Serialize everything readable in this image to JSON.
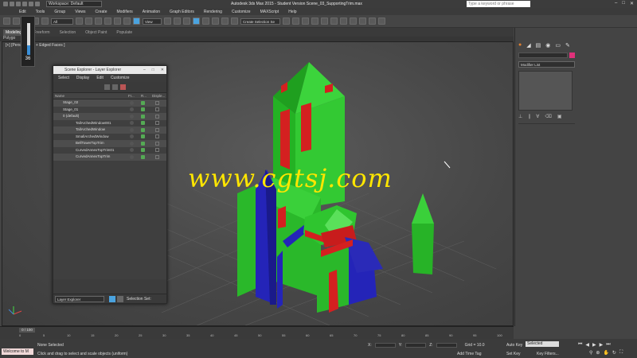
{
  "titlebar": {
    "workspace": "Workspace: Default",
    "app_title": "Autodesk 3ds Max 2015 - Student Version  Scene_03_SupportingTrim.max",
    "search_placeholder": "Type a keyword or phrase"
  },
  "menubar": [
    "Edit",
    "Tools",
    "Group",
    "Views",
    "Create",
    "Modifiers",
    "Animation",
    "Graph Editors",
    "Rendering",
    "Customize",
    "MAXScript",
    "Help"
  ],
  "toolbar": {
    "filter_value": "All",
    "view_value": "View",
    "selection_set_placeholder": "Create Selection Se"
  },
  "ribbon": {
    "tabs": [
      "Modeling",
      "Freeform",
      "Selection",
      "Object Paint",
      "Populate"
    ],
    "sub_label": "Polygo"
  },
  "viewport": {
    "label": "[+] [Pers",
    "label_tail": "alts + Edged Faces ]",
    "watermark": "www.cgtsj.com"
  },
  "counter_widget": {
    "value": "36",
    "level": 0.36
  },
  "scene_explorer": {
    "title": "Scene Explorer - Layer Explorer",
    "menu": [
      "Select",
      "Display",
      "Edit",
      "Customize"
    ],
    "columns": [
      "Name",
      "Fr...",
      "R...",
      "Disple..."
    ],
    "rows": [
      {
        "name": "Stage_02",
        "indent": 1
      },
      {
        "name": "Stage_01",
        "indent": 1
      },
      {
        "name": "0 (default)",
        "indent": 1
      },
      {
        "name": "TallArchedWindow001",
        "indent": 2
      },
      {
        "name": "TallArchedWindow",
        "indent": 2
      },
      {
        "name": "SmallArchedWindow",
        "indent": 2
      },
      {
        "name": "BellTowerTopTrim",
        "indent": 2
      },
      {
        "name": "CurvedAnnexTopTrim01",
        "indent": 2
      },
      {
        "name": "CurvedAnnexTopTrim",
        "indent": 2
      }
    ],
    "footer_dropdown": "Layer Explorer",
    "footer_label": "Selection Set:"
  },
  "command_panel": {
    "modifier_list": "Modifier List"
  },
  "timeline": {
    "frame": "0 / 100",
    "ticks": [
      "0",
      "5",
      "10",
      "15",
      "20",
      "25",
      "30",
      "35",
      "40",
      "45",
      "50",
      "55",
      "60",
      "65",
      "70",
      "75",
      "80",
      "85",
      "90",
      "95",
      "100"
    ]
  },
  "statusbar": {
    "welcome": "Welcome to M",
    "selection": "None Selected",
    "prompt": "Click and drag to select and scale objects (uniform)",
    "x_label": "X:",
    "y_label": "Y:",
    "z_label": "Z:",
    "grid": "Grid = 10.0",
    "auto_key": "Auto Key",
    "selected": "Selected",
    "set_key": "Set Key",
    "key_filters": "Key Filters...",
    "add_time_tag": "Add Time Tag"
  },
  "colors": {
    "green": "#2fc52f",
    "red": "#d42020",
    "blue": "#2424b8",
    "watermark": "#ffe600"
  }
}
